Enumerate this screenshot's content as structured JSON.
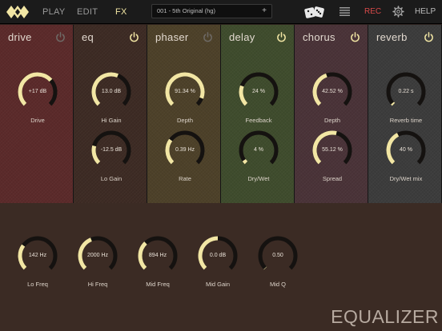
{
  "topbar": {
    "nav": [
      "PLAY",
      "EDIT",
      "FX"
    ],
    "active_tab": "FX",
    "preset_name": "001 - 5th Original (hg)",
    "preset_add": "+",
    "rec_label": "REC",
    "help_label": "HELP",
    "icons": [
      "logo-icon",
      "dice-icon",
      "menu-icon",
      "gear-icon"
    ]
  },
  "panels": [
    {
      "key": "drive",
      "title": "drive",
      "power_on": false,
      "bg": "#5b2a2a",
      "knobs": [
        {
          "label": "Drive",
          "value": "+17 dB",
          "fraction": 0.68
        }
      ]
    },
    {
      "key": "eq",
      "title": "eq",
      "power_on": true,
      "bg": "#3d2b24",
      "knobs": [
        {
          "label": "Hi Gain",
          "value": "13.0 dB",
          "fraction": 0.58
        },
        {
          "label": "Lo Gain",
          "value": "-12.5 dB",
          "fraction": 0.22
        }
      ]
    },
    {
      "key": "phaser",
      "title": "phaser",
      "power_on": false,
      "bg": "#4d4129",
      "knobs": [
        {
          "label": "Depth",
          "value": "91.34 %",
          "fraction": 0.91
        },
        {
          "label": "Rate",
          "value": "0.39  Hz",
          "fraction": 0.3
        }
      ]
    },
    {
      "key": "delay",
      "title": "delay",
      "power_on": true,
      "bg": "#3f4c2d",
      "knobs": [
        {
          "label": "Feedback",
          "value": "24  %",
          "fraction": 0.24
        },
        {
          "label": "Dry/Wet",
          "value": "4  %",
          "fraction": 0.04
        }
      ]
    },
    {
      "key": "chorus",
      "title": "chorus",
      "power_on": true,
      "bg": "#4a3338",
      "knobs": [
        {
          "label": "Depth",
          "value": "42.52 %",
          "fraction": 0.43
        },
        {
          "label": "Spread",
          "value": "55.12 %",
          "fraction": 0.55
        }
      ]
    },
    {
      "key": "reverb",
      "title": "reverb",
      "power_on": true,
      "bg": "#3c3c3c",
      "knobs": [
        {
          "label": "Reverb time",
          "value": "0.22 s",
          "fraction": 0.02
        },
        {
          "label": "Dry/Wet mix",
          "value": "40 %",
          "fraction": 0.4
        }
      ]
    }
  ],
  "equalizer": {
    "title": "EQUALIZER",
    "knobs": [
      {
        "label": "Lo Freq",
        "value": "142 Hz",
        "fraction": 0.3
      },
      {
        "label": "Hi Freq",
        "value": "2000 Hz",
        "fraction": 0.42
      },
      {
        "label": "Mid Freq",
        "value": "894 Hz",
        "fraction": 0.34
      },
      {
        "label": "Mid Gain",
        "value": "0.0 dB",
        "fraction": 0.5
      },
      {
        "label": "Mid Q",
        "value": "0.50",
        "fraction": 0.0
      }
    ]
  },
  "colors": {
    "accent": "#f2e6a4",
    "rec": "#d94a4a",
    "track": "#151210"
  }
}
